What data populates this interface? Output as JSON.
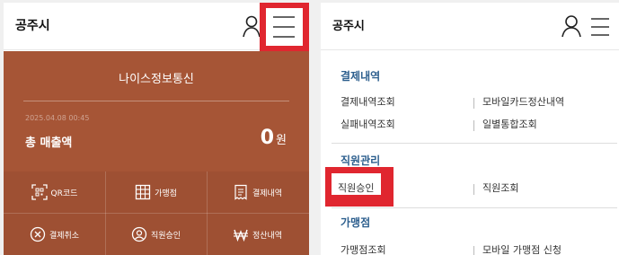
{
  "left": {
    "title": "공주시",
    "company": "나이스정보통신",
    "date": "2025.04.08 00:45",
    "sales_label": "총 매출액",
    "amount": "0",
    "amount_unit": "원",
    "grid": [
      {
        "label": "QR코드",
        "icon": "qr-icon"
      },
      {
        "label": "가맹점",
        "icon": "store-icon"
      },
      {
        "label": "결제내역",
        "icon": "receipt-icon"
      },
      {
        "label": "결제취소",
        "icon": "cancel-icon"
      },
      {
        "label": "직원승인",
        "icon": "staff-icon"
      },
      {
        "label": "정산내역",
        "icon": "won-icon"
      }
    ]
  },
  "right": {
    "title": "공주시",
    "sections": [
      {
        "title": "결제내역",
        "items": [
          [
            "결제내역조회",
            "모바일카드정산내역"
          ],
          [
            "실패내역조회",
            "일별통합조회"
          ]
        ]
      },
      {
        "title": "직원관리",
        "items": [
          [
            "직원승인",
            "직원조회"
          ]
        ]
      },
      {
        "title": "가맹점",
        "items": [
          [
            "가맹점조회",
            "모바일 가맹점 신청"
          ]
        ]
      }
    ]
  },
  "colors": {
    "card": "#a65536",
    "highlight": "#e0262f",
    "section_title": "#2d5f8e"
  }
}
